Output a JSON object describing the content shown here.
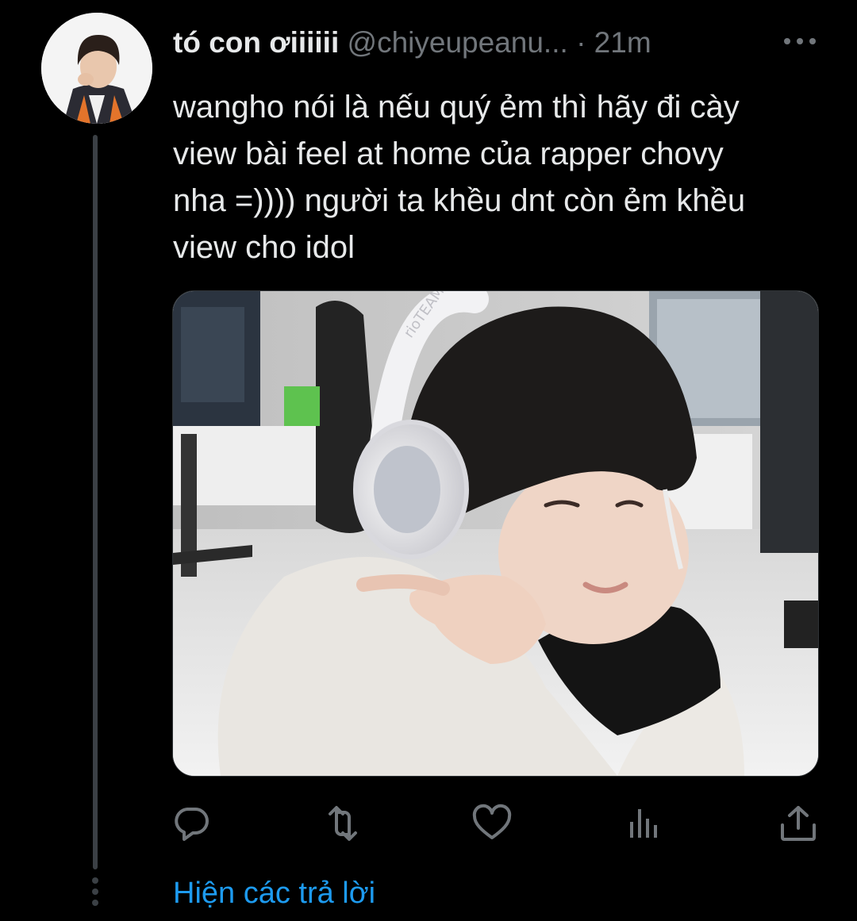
{
  "tweet": {
    "display_name": "tó con ơiiiiii",
    "handle": "@chiyeupeanu...",
    "separator": "·",
    "time": "21m",
    "text": "wangho nói là nếu quý ẻm thì hãy đi cày\nview bài feel at home của rapper chovy\nnha =)))) người ta khều dnt còn ẻm khều\nview cho idol",
    "image_watermark": "rioTEAMO"
  },
  "actions": {
    "reply_icon": "reply-icon",
    "retweet_icon": "retweet-icon",
    "like_icon": "heart-icon",
    "views_icon": "analytics-icon",
    "share_icon": "share-icon"
  },
  "thread": {
    "show_replies_label": "Hiện các trả lời"
  },
  "colors": {
    "background": "#000000",
    "primary_text": "#e7e9ea",
    "secondary_text": "#71767b",
    "link": "#1d9bf0",
    "thread_line": "#3b4045"
  }
}
